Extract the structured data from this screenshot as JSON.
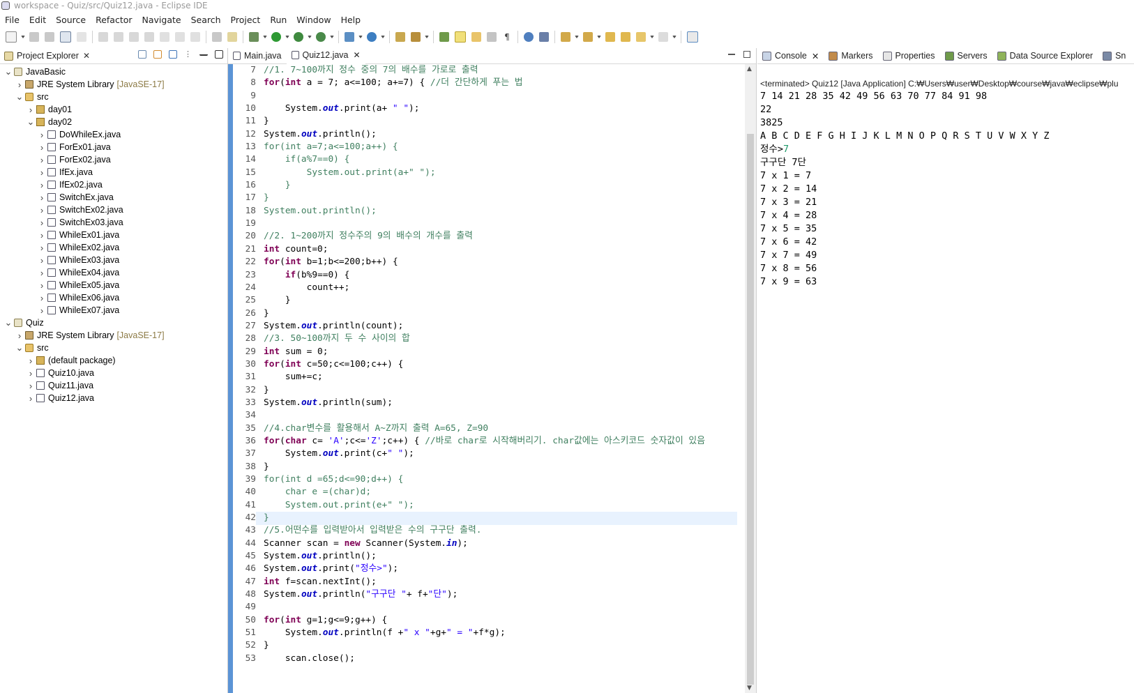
{
  "window": {
    "title": "workspace - Quiz/src/Quiz12.java - Eclipse IDE"
  },
  "menu": [
    "File",
    "Edit",
    "Source",
    "Refactor",
    "Navigate",
    "Search",
    "Project",
    "Run",
    "Window",
    "Help"
  ],
  "explorer": {
    "tab_label": "Project Explorer",
    "tree": [
      {
        "label": "JavaBasic",
        "icon": "project-icon",
        "depth": 0,
        "twisty": "open"
      },
      {
        "label": "JRE System Library",
        "extra": "[JavaSE-17]",
        "icon": "library-icon",
        "depth": 1,
        "twisty": "closed"
      },
      {
        "label": "src",
        "icon": "source-folder-icon",
        "depth": 1,
        "twisty": "open"
      },
      {
        "label": "day01",
        "icon": "package-icon",
        "depth": 2,
        "twisty": "closed"
      },
      {
        "label": "day02",
        "icon": "package-icon",
        "depth": 2,
        "twisty": "open"
      },
      {
        "label": "DoWhileEx.java",
        "icon": "java-file-icon",
        "depth": 3,
        "twisty": "closed"
      },
      {
        "label": "ForEx01.java",
        "icon": "java-file-icon",
        "depth": 3,
        "twisty": "closed"
      },
      {
        "label": "ForEx02.java",
        "icon": "java-file-icon",
        "depth": 3,
        "twisty": "closed"
      },
      {
        "label": "IfEx.java",
        "icon": "java-file-icon",
        "depth": 3,
        "twisty": "closed"
      },
      {
        "label": "IfEx02.java",
        "icon": "java-file-icon",
        "depth": 3,
        "twisty": "closed"
      },
      {
        "label": "SwitchEx.java",
        "icon": "java-file-icon",
        "depth": 3,
        "twisty": "closed"
      },
      {
        "label": "SwitchEx02.java",
        "icon": "java-file-icon",
        "depth": 3,
        "twisty": "closed"
      },
      {
        "label": "SwitchEx03.java",
        "icon": "java-file-icon",
        "depth": 3,
        "twisty": "closed"
      },
      {
        "label": "WhileEx01.java",
        "icon": "java-file-icon",
        "depth": 3,
        "twisty": "closed"
      },
      {
        "label": "WhileEx02.java",
        "icon": "java-file-icon",
        "depth": 3,
        "twisty": "closed"
      },
      {
        "label": "WhileEx03.java",
        "icon": "java-file-icon",
        "depth": 3,
        "twisty": "closed"
      },
      {
        "label": "WhileEx04.java",
        "icon": "java-file-icon",
        "depth": 3,
        "twisty": "closed"
      },
      {
        "label": "WhileEx05.java",
        "icon": "java-file-icon",
        "depth": 3,
        "twisty": "closed"
      },
      {
        "label": "WhileEx06.java",
        "icon": "java-file-icon",
        "depth": 3,
        "twisty": "closed"
      },
      {
        "label": "WhileEx07.java",
        "icon": "java-file-icon",
        "depth": 3,
        "twisty": "closed"
      },
      {
        "label": "Quiz",
        "icon": "project-icon",
        "depth": 0,
        "twisty": "open"
      },
      {
        "label": "JRE System Library",
        "extra": "[JavaSE-17]",
        "icon": "library-icon",
        "depth": 1,
        "twisty": "closed"
      },
      {
        "label": "src",
        "icon": "source-folder-icon",
        "depth": 1,
        "twisty": "open"
      },
      {
        "label": "(default package)",
        "icon": "package-icon",
        "depth": 2,
        "twisty": "closed"
      },
      {
        "label": "Quiz10.java",
        "icon": "java-file-icon",
        "depth": 2,
        "twisty": "closed"
      },
      {
        "label": "Quiz11.java",
        "icon": "java-file-icon",
        "depth": 2,
        "twisty": "closed"
      },
      {
        "label": "Quiz12.java",
        "icon": "java-file-icon",
        "depth": 2,
        "twisty": "closed"
      }
    ]
  },
  "editor": {
    "tabs": [
      {
        "label": "Main.java",
        "active": false
      },
      {
        "label": "Quiz12.java",
        "active": true
      }
    ],
    "current_line": 42,
    "lines": [
      {
        "n": "7",
        "tokens": [
          [
            "cm",
            "//1. 7~100까지 정수 중의 7의 배수를 가로로 출력"
          ]
        ]
      },
      {
        "n": "8",
        "tokens": [
          [
            "kw",
            "for"
          ],
          [
            "",
            "("
          ],
          [
            "kw",
            "int"
          ],
          [
            "",
            " a = 7; a<=100; a+=7) { "
          ],
          [
            "cm",
            "//더 간단하게 푸는 법"
          ]
        ]
      },
      {
        "n": "9",
        "tokens": [
          [
            "",
            ""
          ]
        ]
      },
      {
        "n": "10",
        "tokens": [
          [
            "",
            "    System."
          ],
          [
            "fi",
            "out"
          ],
          [
            "",
            ".print(a+ "
          ],
          [
            "st",
            "\" \""
          ],
          [
            "",
            ");"
          ]
        ]
      },
      {
        "n": "11",
        "tokens": [
          [
            "",
            "}"
          ]
        ]
      },
      {
        "n": "12",
        "tokens": [
          [
            "",
            "System."
          ],
          [
            "fi",
            "out"
          ],
          [
            "",
            ".println();"
          ]
        ]
      },
      {
        "n": "13",
        "tokens": [
          [
            "cm",
            "for(int a=7;a<=100;a++) {"
          ]
        ]
      },
      {
        "n": "14",
        "tokens": [
          [
            "cm",
            "    if(a%7==0) {"
          ]
        ]
      },
      {
        "n": "15",
        "tokens": [
          [
            "cm",
            "        System.out.print(a+\" \");"
          ]
        ]
      },
      {
        "n": "16",
        "tokens": [
          [
            "cm",
            "    }"
          ]
        ]
      },
      {
        "n": "17",
        "tokens": [
          [
            "cm",
            "}"
          ]
        ]
      },
      {
        "n": "18",
        "tokens": [
          [
            "cm",
            "System.out.println();"
          ]
        ]
      },
      {
        "n": "19",
        "tokens": [
          [
            "",
            ""
          ]
        ]
      },
      {
        "n": "20",
        "tokens": [
          [
            "cm",
            "//2. 1~200까지 정수주의 9의 배수의 개수를 출력"
          ]
        ]
      },
      {
        "n": "21",
        "tokens": [
          [
            "kw",
            "int"
          ],
          [
            "",
            " count=0;"
          ]
        ]
      },
      {
        "n": "22",
        "tokens": [
          [
            "kw",
            "for"
          ],
          [
            "",
            "("
          ],
          [
            "kw",
            "int"
          ],
          [
            "",
            " b=1;b<=200;b++) {"
          ]
        ]
      },
      {
        "n": "23",
        "tokens": [
          [
            "",
            "    "
          ],
          [
            "kw",
            "if"
          ],
          [
            "",
            "(b%9==0) {"
          ]
        ]
      },
      {
        "n": "24",
        "tokens": [
          [
            "",
            "        count++;"
          ]
        ]
      },
      {
        "n": "25",
        "tokens": [
          [
            "",
            "    }"
          ]
        ]
      },
      {
        "n": "26",
        "tokens": [
          [
            "",
            "}"
          ]
        ]
      },
      {
        "n": "27",
        "tokens": [
          [
            "",
            "System."
          ],
          [
            "fi",
            "out"
          ],
          [
            "",
            ".println(count);"
          ]
        ]
      },
      {
        "n": "28",
        "tokens": [
          [
            "cm",
            "//3. 50~100까지 두 수 사이의 합"
          ]
        ]
      },
      {
        "n": "29",
        "tokens": [
          [
            "kw",
            "int"
          ],
          [
            "",
            " sum = 0;"
          ]
        ]
      },
      {
        "n": "30",
        "tokens": [
          [
            "kw",
            "for"
          ],
          [
            "",
            "("
          ],
          [
            "kw",
            "int"
          ],
          [
            "",
            " c=50;c<=100;c++) {"
          ]
        ]
      },
      {
        "n": "31",
        "tokens": [
          [
            "",
            "    sum+=c;"
          ]
        ]
      },
      {
        "n": "32",
        "tokens": [
          [
            "",
            "}"
          ]
        ]
      },
      {
        "n": "33",
        "tokens": [
          [
            "",
            "System."
          ],
          [
            "fi",
            "out"
          ],
          [
            "",
            ".println(sum);"
          ]
        ]
      },
      {
        "n": "34",
        "tokens": [
          [
            "",
            ""
          ]
        ]
      },
      {
        "n": "35",
        "tokens": [
          [
            "cm",
            "//4.char변수를 활용해서 A~Z까지 출력 A=65, Z=90"
          ]
        ]
      },
      {
        "n": "36",
        "tokens": [
          [
            "kw",
            "for"
          ],
          [
            "",
            "("
          ],
          [
            "kw",
            "char"
          ],
          [
            "",
            " c= "
          ],
          [
            "st",
            "'A'"
          ],
          [
            "",
            ";c<="
          ],
          [
            "st",
            "'Z'"
          ],
          [
            "",
            ";c++) { "
          ],
          [
            "cm",
            "//바로 char로 시작해버리기. char값에는 아스키코드 숫자값이 있음"
          ]
        ]
      },
      {
        "n": "37",
        "tokens": [
          [
            "",
            "    System."
          ],
          [
            "fi",
            "out"
          ],
          [
            "",
            ".print(c+"
          ],
          [
            "st",
            "\" \""
          ],
          [
            "",
            ");"
          ]
        ]
      },
      {
        "n": "38",
        "tokens": [
          [
            "",
            "}"
          ]
        ]
      },
      {
        "n": "39",
        "tokens": [
          [
            "cm",
            "for(int d =65;d<=90;d++) {"
          ]
        ]
      },
      {
        "n": "40",
        "tokens": [
          [
            "cm",
            "    char e =(char)d;"
          ]
        ]
      },
      {
        "n": "41",
        "tokens": [
          [
            "cm",
            "    System.out.print(e+\" \");"
          ]
        ]
      },
      {
        "n": "42",
        "tokens": [
          [
            "cm",
            "}"
          ]
        ]
      },
      {
        "n": "43",
        "tokens": [
          [
            "cm",
            "//5.어떤수를 입력받아서 입력받은 수의 구구단 출력."
          ]
        ]
      },
      {
        "n": "44",
        "tokens": [
          [
            "",
            "Scanner scan = "
          ],
          [
            "kw",
            "new"
          ],
          [
            "",
            " Scanner(System."
          ],
          [
            "fi",
            "in"
          ],
          [
            "",
            ");"
          ]
        ]
      },
      {
        "n": "45",
        "tokens": [
          [
            "",
            "System."
          ],
          [
            "fi",
            "out"
          ],
          [
            "",
            ".println();"
          ]
        ]
      },
      {
        "n": "46",
        "tokens": [
          [
            "",
            "System."
          ],
          [
            "fi",
            "out"
          ],
          [
            "",
            ".print("
          ],
          [
            "st",
            "\"정수>\""
          ],
          [
            "",
            ");"
          ]
        ]
      },
      {
        "n": "47",
        "tokens": [
          [
            "kw",
            "int"
          ],
          [
            "",
            " f=scan.nextInt();"
          ]
        ]
      },
      {
        "n": "48",
        "tokens": [
          [
            "",
            "System."
          ],
          [
            "fi",
            "out"
          ],
          [
            "",
            ".println("
          ],
          [
            "st",
            "\"구구단 \""
          ],
          [
            "",
            "+ f+"
          ],
          [
            "st",
            "\"단\""
          ],
          [
            "",
            ");"
          ]
        ]
      },
      {
        "n": "49",
        "tokens": [
          [
            "",
            ""
          ]
        ]
      },
      {
        "n": "50",
        "tokens": [
          [
            "kw",
            "for"
          ],
          [
            "",
            "("
          ],
          [
            "kw",
            "int"
          ],
          [
            "",
            " g=1;g<=9;g++) {"
          ]
        ]
      },
      {
        "n": "51",
        "tokens": [
          [
            "",
            "    System."
          ],
          [
            "fi",
            "out"
          ],
          [
            "",
            ".println(f +"
          ],
          [
            "st",
            "\" x \""
          ],
          [
            "",
            "+g+"
          ],
          [
            "st",
            "\" = \""
          ],
          [
            "",
            "+f*g);"
          ]
        ]
      },
      {
        "n": "52",
        "tokens": [
          [
            "",
            "}"
          ]
        ]
      },
      {
        "n": "53",
        "tokens": [
          [
            "",
            "    scan.close();"
          ]
        ]
      }
    ]
  },
  "console": {
    "tabs": [
      {
        "label": "Console",
        "icon": "console-icon",
        "closable": true
      },
      {
        "label": "Markers",
        "icon": "markers-icon",
        "closable": false
      },
      {
        "label": "Properties",
        "icon": "properties-icon",
        "closable": false
      },
      {
        "label": "Servers",
        "icon": "servers-icon",
        "closable": false
      },
      {
        "label": "Data Source Explorer",
        "icon": "data-source-icon",
        "closable": false
      },
      {
        "label": "Sn",
        "icon": "snippets-icon",
        "closable": false
      }
    ],
    "status": "<terminated> Quiz12 [Java Application] C:₩Users₩user₩Desktop₩course₩java₩eclipse₩plu",
    "output": [
      "7 14 21 28 35 42 49 56 63 70 77 84 91 98",
      "22",
      "3825",
      "A B C D E F G H I J K L M N O P Q R S T U V W X Y Z"
    ],
    "prompt": "정수>",
    "input_value": "7",
    "output_after": [
      "구구단 7단",
      "7 x 1 = 7",
      "7 x 2 = 14",
      "7 x 3 = 21",
      "7 x 4 = 28",
      "7 x 5 = 35",
      "7 x 6 = 42",
      "7 x 7 = 49",
      "7 x 8 = 56",
      "7 x 9 = 63"
    ]
  }
}
